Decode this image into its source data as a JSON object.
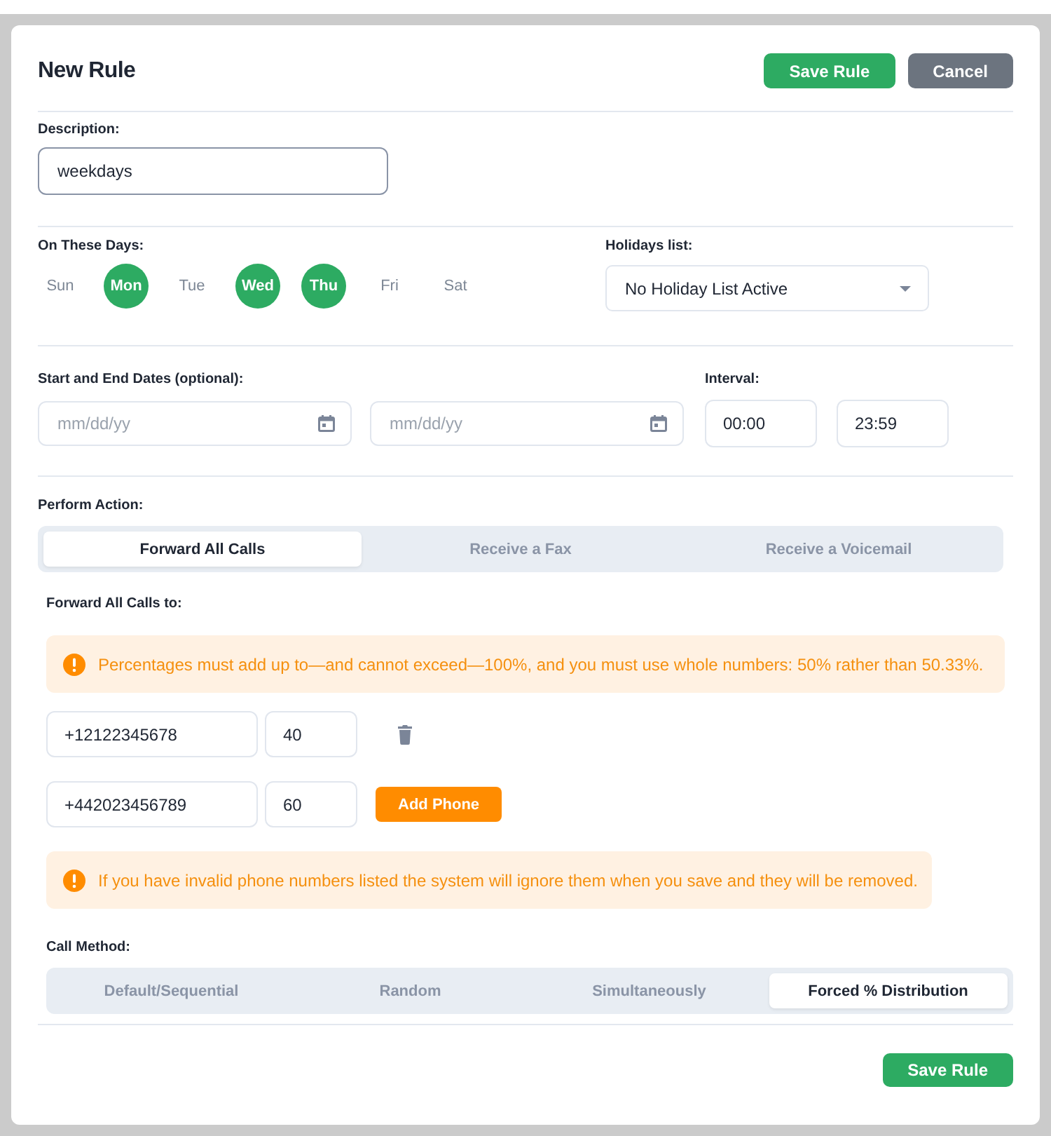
{
  "header": {
    "title": "New Rule",
    "buttons": [
      {
        "label": "Save Rule",
        "kind": "primary"
      },
      {
        "label": "Cancel",
        "kind": "secondary"
      }
    ]
  },
  "description": {
    "label": "Description:",
    "value": "weekdays"
  },
  "days": {
    "label": "On These Days:",
    "items": [
      {
        "label": "Sun",
        "selected": false
      },
      {
        "label": "Mon",
        "selected": true
      },
      {
        "label": "Tue",
        "selected": false
      },
      {
        "label": "Wed",
        "selected": true
      },
      {
        "label": "Thu",
        "selected": true
      },
      {
        "label": "Fri",
        "selected": false
      },
      {
        "label": "Sat",
        "selected": false
      }
    ]
  },
  "holidays": {
    "label": "Holidays list:",
    "value": "No Holiday List Active"
  },
  "dates": {
    "label": "Start and End Dates (optional):",
    "fields": [
      {
        "placeholder": "mm/dd/yy"
      },
      {
        "placeholder": "mm/dd/yy"
      }
    ]
  },
  "interval": {
    "label": "Interval:",
    "fields": [
      {
        "value": "00:00"
      },
      {
        "value": "23:59"
      }
    ]
  },
  "perform_action": {
    "label": "Perform Action:",
    "tabs": [
      {
        "label": "Forward All Calls",
        "selected": true
      },
      {
        "label": "Receive a Fax",
        "selected": false
      },
      {
        "label": "Receive a Voicemail",
        "selected": false
      }
    ]
  },
  "forward": {
    "label": "Forward All Calls to:",
    "notice": "Percentages must add up to—and cannot exceed—100%, and you must use whole numbers: 50% rather than 50.33%.",
    "phones": [
      {
        "number": "+12122345678",
        "percent": "40",
        "kind": "delete"
      },
      {
        "number": "+442023456789",
        "percent": "60",
        "kind": "add",
        "button": "Add Phone"
      }
    ],
    "footer_notice": "If you have invalid phone numbers listed the system will ignore them when you save and they will be removed."
  },
  "call_method": {
    "label": "Call Method:",
    "tabs": [
      {
        "label": "Default/Sequential",
        "selected": false
      },
      {
        "label": "Random",
        "selected": false
      },
      {
        "label": "Simultaneously",
        "selected": false
      },
      {
        "label": "Forced % Distribution",
        "selected": true
      }
    ]
  },
  "footer": {
    "buttons": [
      {
        "label": "Save Rule",
        "kind": "primary"
      }
    ]
  }
}
